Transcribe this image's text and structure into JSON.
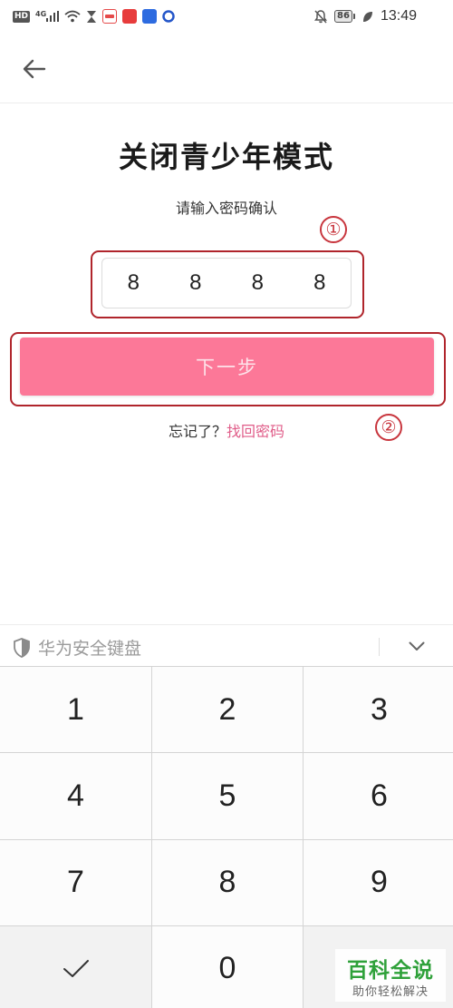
{
  "status_bar": {
    "hd": "HD",
    "network": "4G",
    "time": "13:49",
    "battery": "86"
  },
  "page": {
    "title": "关闭青少年模式",
    "instruction": "请输入密码确认",
    "pin_digits": [
      "8",
      "8",
      "8",
      "8"
    ],
    "next_label": "下一步",
    "forgot_text": "忘记了？",
    "recover_link": "找回密码",
    "accent_color": "#fc7898",
    "link_color": "#e05d89"
  },
  "annotations": {
    "marker_1": "①",
    "marker_2": "②",
    "highlight_color": "#b0252c"
  },
  "keyboard": {
    "brand": "华为安全键盘",
    "keys": [
      "1",
      "2",
      "3",
      "4",
      "5",
      "6",
      "7",
      "8",
      "9",
      "0"
    ]
  },
  "watermark": {
    "main": "百科全说",
    "sub": "助你轻松解决"
  }
}
